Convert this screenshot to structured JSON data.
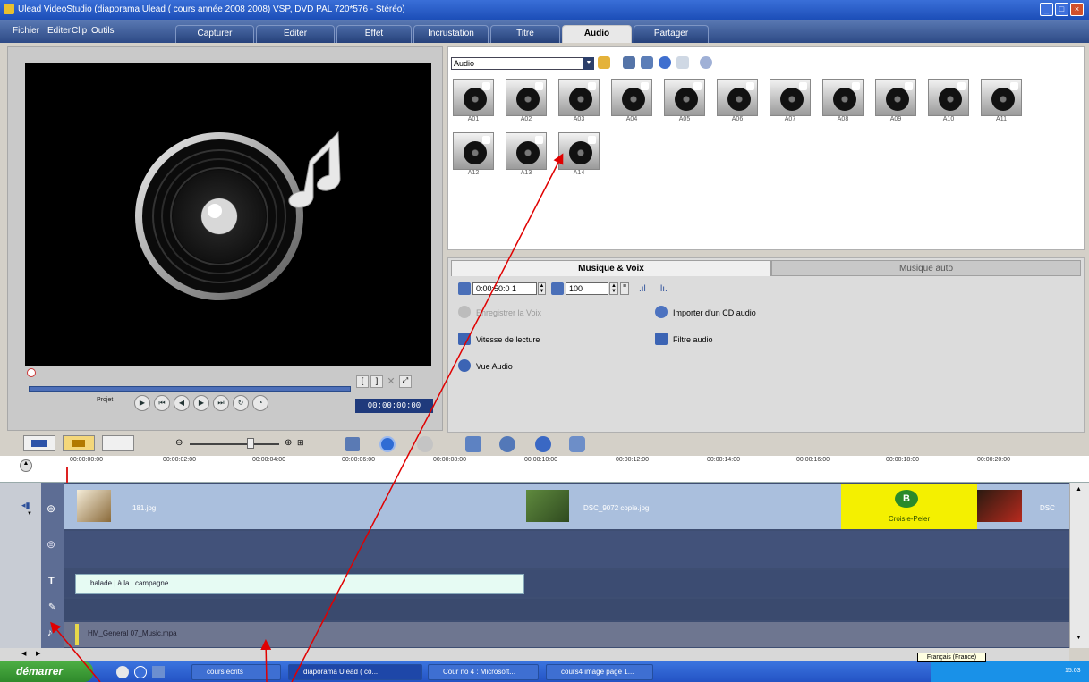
{
  "window": {
    "title": "Ulead VideoStudio (diaporama Ulead ( cours année 2008 2008) VSP, DVD PAL 720*576 - Stéréo)"
  },
  "menu": [
    "Fichier",
    "Editer",
    "Clip",
    "Outils"
  ],
  "tabs": [
    "Capturer",
    "Editer",
    "Effet",
    "Incrustation",
    "Titre",
    "Audio",
    "Partager"
  ],
  "active_tab": "Audio",
  "preview": {
    "project_label": "Projet",
    "timecode": "00:00:00:00"
  },
  "library": {
    "category": "Audio",
    "items": [
      "A01",
      "A02",
      "A03",
      "A04",
      "A05",
      "A06",
      "A07",
      "A08",
      "A09",
      "A10",
      "A11",
      "A12",
      "A13",
      "A14"
    ]
  },
  "options": {
    "tab_active": "Musique & Voix",
    "tab_other": "Musique auto",
    "duration": "0:00:50:0 1",
    "volume": "100",
    "record_voice": "Enregistrer la Voix",
    "import_cd": "Importer d'un CD audio",
    "playback_speed": "Vitesse de lecture",
    "audio_filter": "Filtre audio",
    "audio_view": "Vue Audio"
  },
  "timeline": {
    "ruler": [
      "00:00:00:00",
      "00:00:02:00",
      "00:00:04:00",
      "00:00:06:00",
      "00:00:08:00",
      "00:00:10:00",
      "00:00:12:00",
      "00:00:14:00",
      "00:00:16:00",
      "00:00:18:00",
      "00:00:20:00"
    ],
    "video_clips": [
      "181.jpg",
      "DSC_9072 copie.jpg",
      "Croisie-Peler",
      "DSC"
    ],
    "title_clip": "balade | à la | campagne",
    "music_clip": "HM_General 07_Music.mpa"
  },
  "taskbar": {
    "start": "démarrer",
    "items": [
      "cours écrits",
      "diaporama Ulead ( co...",
      "Cour no 4 : Microsoft...",
      "cours4 image page 1..."
    ],
    "tooltip": "Français (France)",
    "clock": "15:03"
  },
  "colors": {
    "title_bar": "#2456c8",
    "annotation": "#e00000",
    "video_track": "#aabfdd",
    "title_track": "#e6fbf3",
    "yellow_clip": "#f4f000"
  }
}
